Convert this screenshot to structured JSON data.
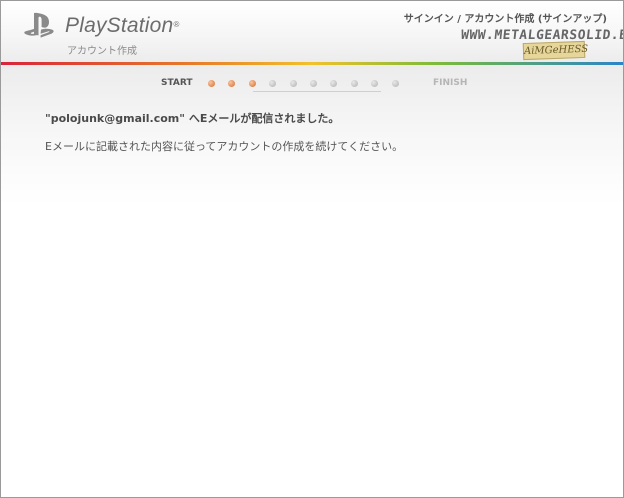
{
  "header": {
    "brand": "PlayStation",
    "trademark": "®",
    "subtitle": "アカウント作成",
    "page_heading": "サインイン / アカウント作成 (サインアップ)",
    "watermark": "WWW.METALGEARSOLID.BE",
    "watermark_tag": "AiMGeHESS"
  },
  "progress": {
    "start_label": "START",
    "finish_label": "FINISH",
    "total_steps": 10,
    "completed_steps": 3,
    "active_color": "#d86a26",
    "inactive_color": "#b0b0b0"
  },
  "content": {
    "confirmation": "\"polojunk@gmail.com\" へEメールが配信されました。",
    "instruction": "Eメールに記載された内容に従ってアカウントの作成を続けてください。"
  },
  "colors": {
    "rainbow": [
      "#d8243b",
      "#e6792a",
      "#f2c12c",
      "#7cbb3a",
      "#2a84c9"
    ]
  }
}
